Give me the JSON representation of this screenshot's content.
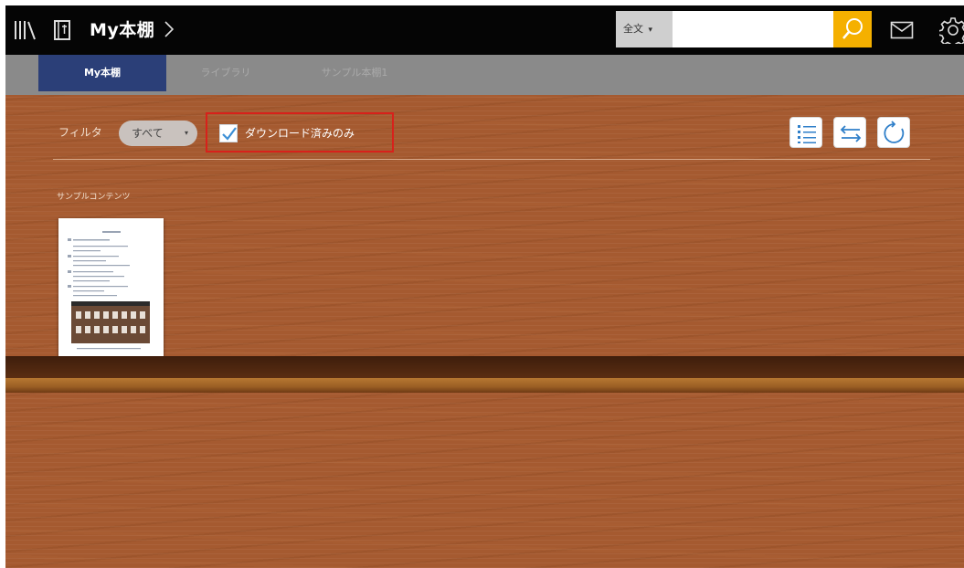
{
  "header": {
    "title": "My本棚",
    "search": {
      "scope_label": "全文",
      "scope_caret": "▾",
      "input_value": "",
      "placeholder": ""
    },
    "icons": [
      "library-icon",
      "book-icon",
      "chevron-right-icon",
      "search-icon",
      "mail-icon",
      "gear-icon"
    ]
  },
  "tabs": [
    {
      "label": "My本棚",
      "active": true
    },
    {
      "label": "ライブラリ",
      "active": false
    },
    {
      "label": "サンプル本棚1",
      "active": false
    }
  ],
  "filter": {
    "label": "フィルタ",
    "dropdown_value": "すべて",
    "dropdown_caret": "▾",
    "download_only_label": "ダウンロード済みのみ",
    "download_only_checked": true
  },
  "toolbar": {
    "icons": [
      "list-view-icon",
      "sort-icon",
      "refresh-icon"
    ]
  },
  "section": {
    "label": "サンプルコンテンツ"
  },
  "colors": {
    "accent_tab": "#2b3f78",
    "search_button": "#f5b000",
    "highlight_border": "#d8211b",
    "wood": "#a55a30"
  }
}
